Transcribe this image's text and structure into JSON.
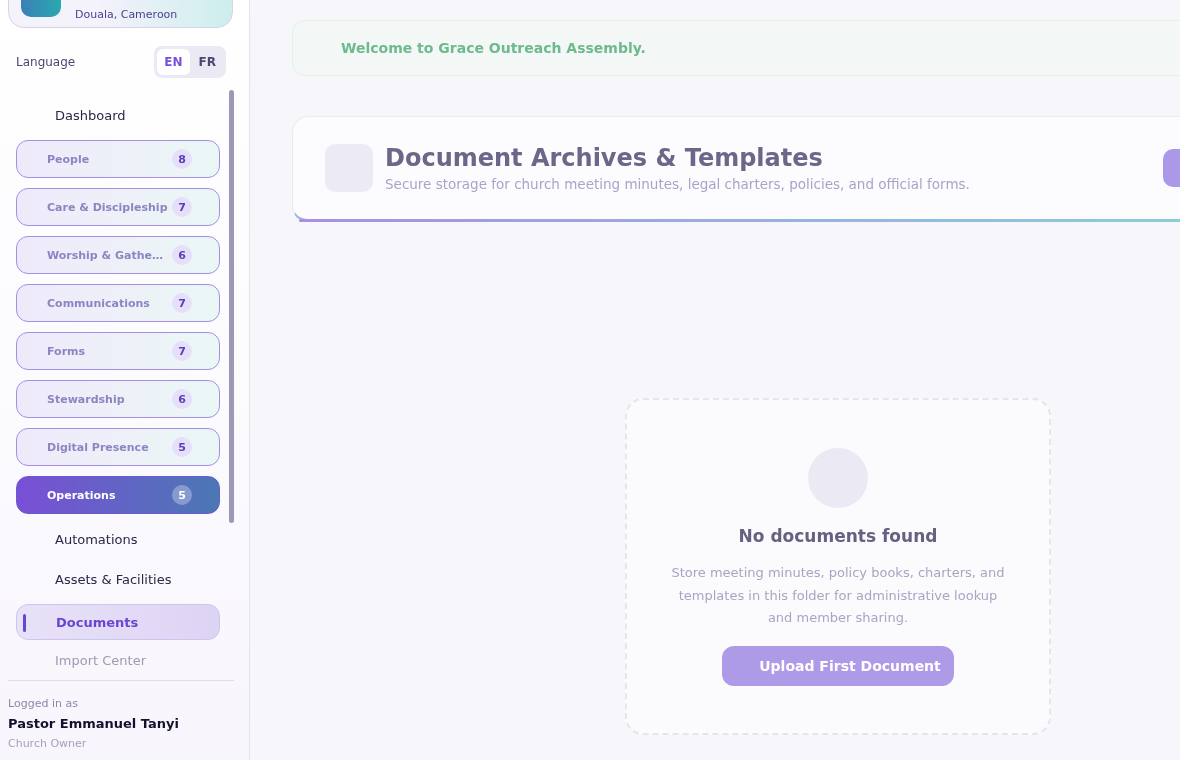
{
  "church": {
    "location": "Douala, Cameroon"
  },
  "language": {
    "label": "Language",
    "options": [
      {
        "label": "EN",
        "selected": true
      },
      {
        "label": "FR",
        "selected": false
      }
    ]
  },
  "nav": [
    {
      "kind": "link",
      "label": "Dashboard",
      "selected": false
    },
    {
      "kind": "group",
      "label": "People",
      "count": "8",
      "selected": false
    },
    {
      "kind": "group",
      "label": "Care & Discipleship",
      "count": "7",
      "selected": false
    },
    {
      "kind": "group",
      "label": "Worship & Gathe…",
      "count": "6",
      "selected": false
    },
    {
      "kind": "group",
      "label": "Communications",
      "count": "7",
      "selected": false
    },
    {
      "kind": "group",
      "label": "Forms",
      "count": "7",
      "selected": false
    },
    {
      "kind": "group",
      "label": "Stewardship",
      "count": "6",
      "selected": false
    },
    {
      "kind": "group",
      "label": "Digital Presence",
      "count": "5",
      "selected": false
    },
    {
      "kind": "group",
      "label": "Operations",
      "count": "5",
      "selected": true
    },
    {
      "kind": "link",
      "label": "Automations",
      "selected": false
    },
    {
      "kind": "link",
      "label": "Assets & Facilities",
      "selected": false
    },
    {
      "kind": "link",
      "label": "Documents",
      "selected": true
    },
    {
      "kind": "link",
      "label": "Import Center",
      "selected": false
    }
  ],
  "user": {
    "caption": "Logged in as",
    "name": "Pastor Emmanuel Tanyi",
    "role": "Church Owner"
  },
  "banner": "Welcome to Grace Outreach Assembly.",
  "header": {
    "title": "Document Archives & Templates",
    "subtitle": "Secure storage for church meeting minutes, legal charters, policies, and official forms."
  },
  "empty": {
    "title": "No documents found",
    "text": "Store meeting minutes, policy books, charters, and templates in this folder for administrative lookup and member sharing.",
    "button": "Upload First Document"
  }
}
